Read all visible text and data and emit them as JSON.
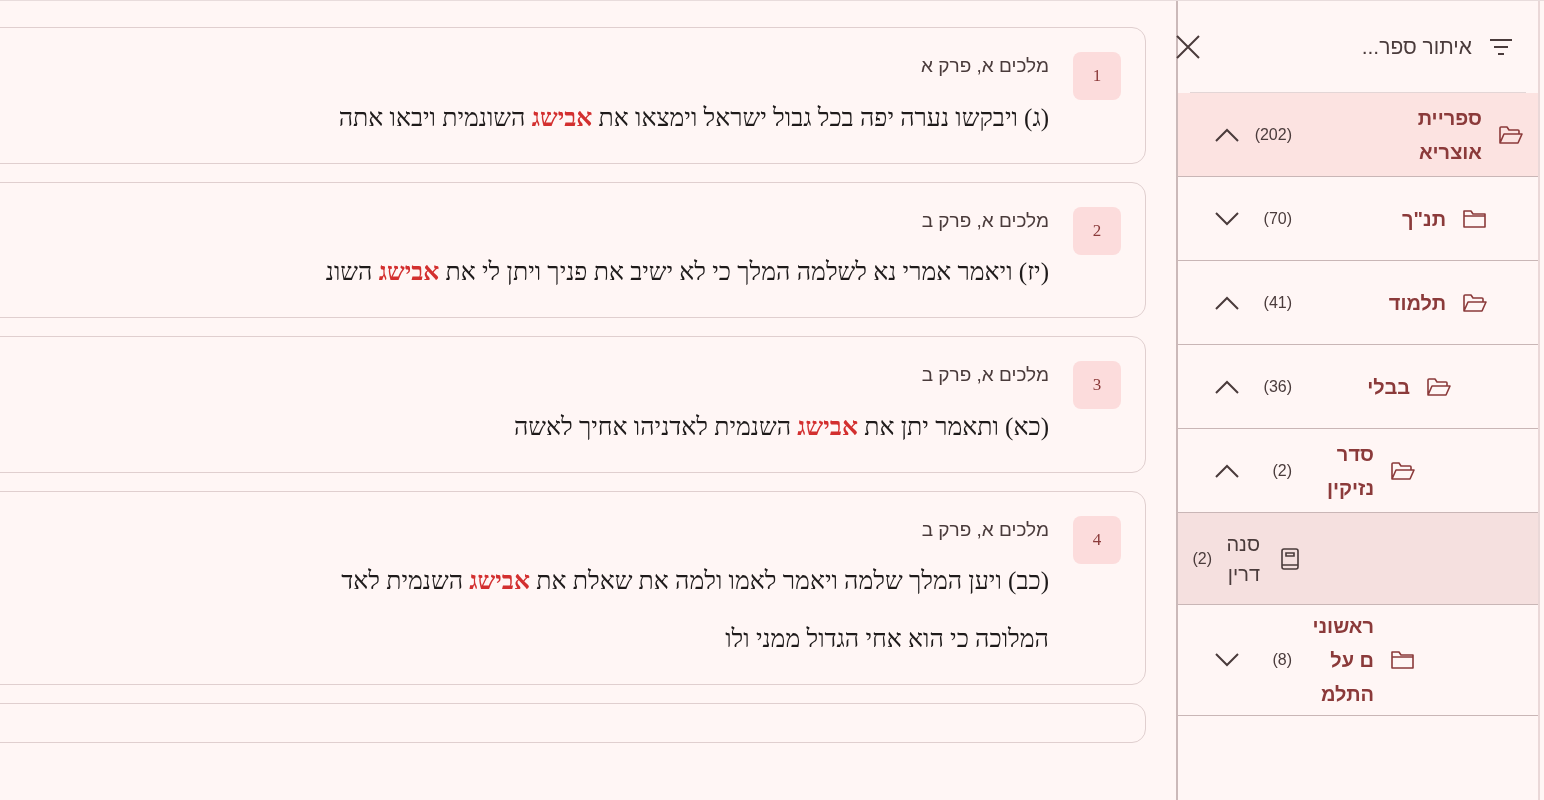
{
  "results": [
    {
      "number": "1",
      "source": "מלכים א, פרק א",
      "lines": [
        "(ג) ויבקשו נערה יפה בכל גבול ישראל וימצאו את **אבישג** השונמית ויבאו אתה"
      ]
    },
    {
      "number": "2",
      "source": "מלכים א, פרק ב",
      "lines": [
        "(יז) ויאמר אמרי נא לשלמה המלך כי לא ישיב את פניך ויתן לי את **אבישג** השונ"
      ]
    },
    {
      "number": "3",
      "source": "מלכים א, פרק ב",
      "lines": [
        "(כא) ותאמר יתן את **אבישג** השנמית לאדניהו אחיך לאשה"
      ]
    },
    {
      "number": "4",
      "source": "מלכים א, פרק ב",
      "lines": [
        "(כב) ויען המלך שלמה ויאמר לאמו ולמה את שאלת את **אבישג** השנמית לאד",
        "המלוכה כי הוא אחי הגדול ממני ולו"
      ]
    }
  ],
  "filter": {
    "placeholder": "איתור ספר..."
  },
  "tree": [
    {
      "kind": "folder",
      "label": "ספריית אוצריא",
      "count": "(202)",
      "expanded": true,
      "selected": true,
      "children": [
        {
          "kind": "folder",
          "label": "תנ\"ך",
          "count": "(70)",
          "expanded": false,
          "selected": false
        },
        {
          "kind": "folder",
          "label": "תלמוד",
          "count": "(41)",
          "expanded": true,
          "selected": false,
          "children": [
            {
              "kind": "folder",
              "label": "בבלי",
              "count": "(36)",
              "expanded": true,
              "selected": false,
              "children": [
                {
                  "kind": "folder",
                  "label": "סדר נזיקין",
                  "count": "(2)",
                  "expanded": true,
                  "selected": false,
                  "children": [
                    {
                      "kind": "book",
                      "label": "סנהדרין",
                      "count": "(2)",
                      "selected": true
                    }
                  ]
                },
                {
                  "kind": "folder",
                  "label": "ראשונים על התלמ",
                  "count": "(8)",
                  "expanded": false,
                  "selected": false
                }
              ]
            }
          ]
        }
      ]
    }
  ]
}
